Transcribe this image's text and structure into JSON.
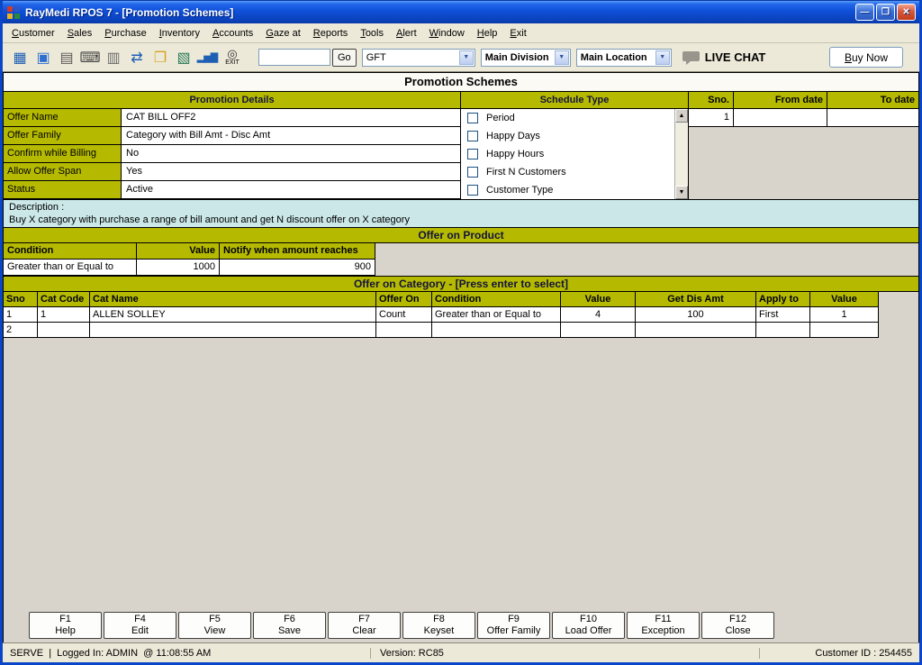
{
  "window": {
    "title": "RayMedi RPOS 7 - [Promotion Schemes]",
    "controls": {
      "minimize": "—",
      "restore": "❐",
      "close": "✕"
    }
  },
  "menu": {
    "items": [
      "Customer",
      "Sales",
      "Purchase",
      "Inventory",
      "Accounts",
      "Gaze at",
      "Reports",
      "Tools",
      "Alert",
      "Window",
      "Help",
      "Exit"
    ]
  },
  "toolbar": {
    "icons": [
      {
        "name": "billing-icon",
        "glyph": "▦"
      },
      {
        "name": "save-icon",
        "glyph": "▣"
      },
      {
        "name": "print-icon",
        "glyph": "▤"
      },
      {
        "name": "keyboard-icon",
        "glyph": "⌨"
      },
      {
        "name": "notes-icon",
        "glyph": "▥"
      },
      {
        "name": "transfer-icon",
        "glyph": "⇄"
      },
      {
        "name": "folder-icon",
        "glyph": "❐"
      },
      {
        "name": "image-icon",
        "glyph": "▧"
      },
      {
        "name": "chart-icon",
        "glyph": "▂▅▇"
      },
      {
        "name": "exit-icon",
        "glyph": "◎"
      }
    ],
    "exit_label": "EXIT",
    "search_value": "",
    "go_label": "Go",
    "combos": [
      {
        "value": "GFT"
      },
      {
        "value": "Main Division"
      },
      {
        "value": "Main Location"
      }
    ],
    "combo_arrow": "▼",
    "scroll_up": "▲",
    "scroll_down": "▼",
    "live_chat_label": "LIVE CHAT",
    "buy_now_label": "Buy Now"
  },
  "page": {
    "title": "Promotion Schemes"
  },
  "promotion_details": {
    "header": "Promotion Details",
    "fields": [
      {
        "label": "Offer Name",
        "value": "CAT BILL OFF2"
      },
      {
        "label": "Offer Family",
        "value": "Category with Bill Amt - Disc Amt"
      },
      {
        "label": "Confirm while Billing",
        "value": "No"
      },
      {
        "label": "Allow Offer Span",
        "value": "Yes"
      },
      {
        "label": "Status",
        "value": "Active"
      }
    ]
  },
  "schedule": {
    "header": "Schedule Type",
    "options": [
      "Period",
      "Happy Days",
      "Happy Hours",
      "First N Customers",
      "Customer Type"
    ],
    "sno_header": "Sno.",
    "from_header": "From date",
    "to_header": "To date",
    "sno_value": "1",
    "from_value": "",
    "to_value": ""
  },
  "description": {
    "label": "Description :",
    "text": "Buy X category with purchase a range of bill amount and get N discount offer on X category"
  },
  "offer_on_product": {
    "header": "Offer on Product",
    "columns": [
      "Condition",
      "Value",
      "Notify when amount reaches"
    ],
    "row": {
      "condition": "Greater than or Equal to",
      "value": "1000",
      "notify": "900"
    }
  },
  "offer_on_category": {
    "header": "Offer on Category - [Press enter to select]",
    "columns": [
      "Sno",
      "Cat Code",
      "Cat Name",
      "Offer On",
      "Condition",
      "Value",
      "Get Dis Amt",
      "Apply to",
      "Value"
    ],
    "rows": [
      {
        "sno": "1",
        "cat_code": "1",
        "cat_name": "ALLEN SOLLEY",
        "offer_on": "Count",
        "condition": "Greater than or Equal to",
        "value": "4",
        "get_dis_amt": "100",
        "apply_to": "First",
        "value2": "1"
      },
      {
        "sno": "2",
        "cat_code": "",
        "cat_name": "",
        "offer_on": "",
        "condition": "",
        "value": "",
        "get_dis_amt": "",
        "apply_to": "",
        "value2": ""
      }
    ]
  },
  "function_keys": [
    {
      "key": "F1",
      "label": "Help"
    },
    {
      "key": "F4",
      "label": "Edit"
    },
    {
      "key": "F5",
      "label": "View"
    },
    {
      "key": "F6",
      "label": "Save"
    },
    {
      "key": "F7",
      "label": "Clear"
    },
    {
      "key": "F8",
      "label": "Keyset"
    },
    {
      "key": "F9",
      "label": "Offer Family"
    },
    {
      "key": "F10",
      "label": "Load Offer"
    },
    {
      "key": "F11",
      "label": "Exception"
    },
    {
      "key": "F12",
      "label": "Close"
    }
  ],
  "status": {
    "left": "SERVE  |  Logged In: ADMIN  @ 11:08:55 AM",
    "center": "Version: RC85",
    "right": "Customer ID : 254455"
  }
}
